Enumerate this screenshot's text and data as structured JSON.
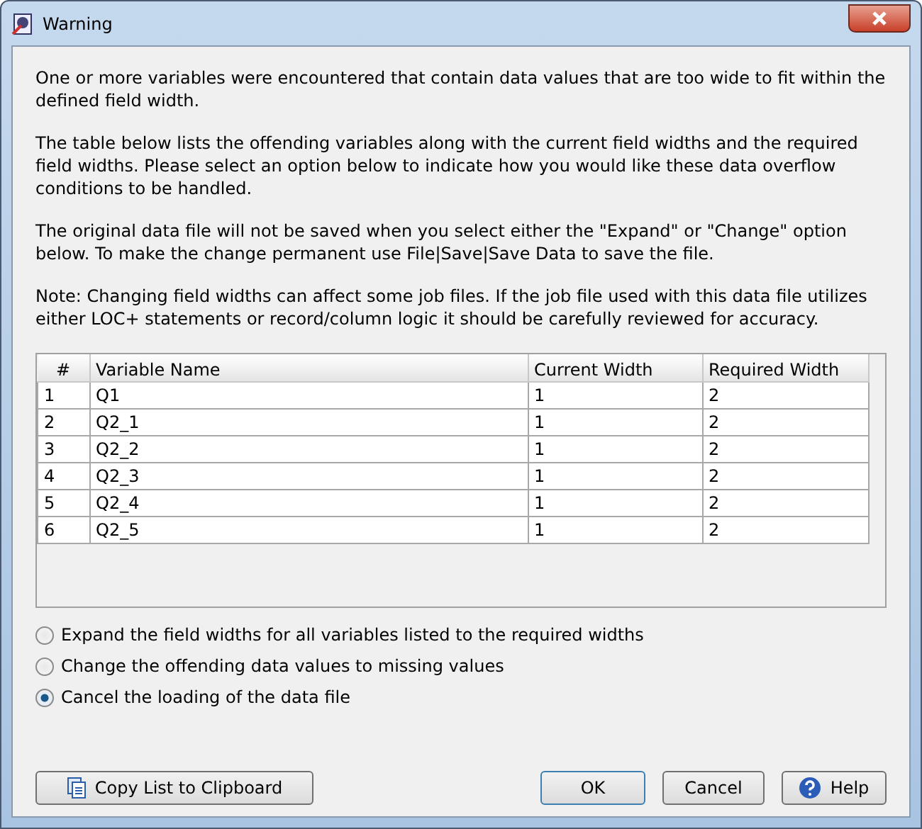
{
  "window": {
    "title": "Warning"
  },
  "paragraphs": [
    "One or more variables were encountered that contain data values that are too wide to fit within the defined field width.",
    "The table below lists the offending variables along with the current field widths and the required field widths. Please select an option below to indicate how you would like these data overflow conditions to be handled.",
    "The original data file will not be saved when you select either the \"Expand\" or \"Change\" option below. To make the change permanent use File|Save|Save Data to save the file.",
    "Note: Changing field widths can affect some job files. If the job file used with this data file utilizes either LOC+ statements or record/column logic it should be carefully reviewed for accuracy."
  ],
  "table": {
    "columns": [
      "#",
      "Variable Name",
      "Current Width",
      "Required Width"
    ],
    "rows": [
      [
        "1",
        "Q1",
        "1",
        "2"
      ],
      [
        "2",
        "Q2_1",
        "1",
        "2"
      ],
      [
        "3",
        "Q2_2",
        "1",
        "2"
      ],
      [
        "4",
        "Q2_3",
        "1",
        "2"
      ],
      [
        "5",
        "Q2_4",
        "1",
        "2"
      ],
      [
        "6",
        "Q2_5",
        "1",
        "2"
      ]
    ]
  },
  "options": [
    {
      "label": "Expand the field widths for all variables listed to the required widths",
      "selected": false
    },
    {
      "label": "Change the offending data values to missing values",
      "selected": false
    },
    {
      "label": "Cancel the loading of the data file",
      "selected": true
    }
  ],
  "buttons": {
    "copy": "Copy List to Clipboard",
    "ok": "OK",
    "cancel": "Cancel",
    "help": "Help"
  }
}
